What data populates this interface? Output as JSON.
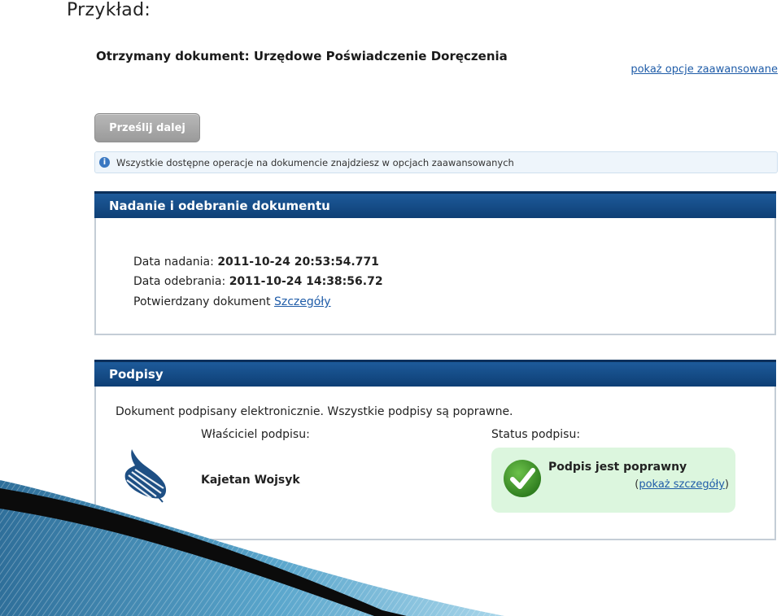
{
  "slide": {
    "title": "Przykład:"
  },
  "document": {
    "title": "Otrzymany dokument: Urzędowe Poświadczenie Doręczenia",
    "advanced_link": "pokaż opcje zaawansowane",
    "forward_button": "Prześlij dalej",
    "info_text": "Wszystkie dostępne operacje na dokumencie znajdziesz w opcjach zaawansowanych"
  },
  "delivery_panel": {
    "title": "Nadanie i odebranie dokumentu",
    "sent_label": "Data nadania:",
    "sent_value": "2011-10-24 20:53:54.771",
    "received_label": "Data odebrania:",
    "received_value": "2011-10-24 14:38:56.72",
    "confirmed_label": "Potwierdzany dokument",
    "details_link": "Szczegóły"
  },
  "signatures_panel": {
    "title": "Podpisy",
    "intro": "Dokument podpisany elektronicznie. Wszystkie podpisy są poprawne.",
    "owner_label": "Właściciel podpisu:",
    "status_label": "Status podpisu:",
    "owner_name": "Kajetan Wojsyk",
    "status_text": "Podpis jest poprawny",
    "details_open": "(",
    "details_link": "pokaż szczegóły",
    "details_close": ")"
  },
  "colors": {
    "header_blue": "#0e3f75",
    "link_blue": "#1f5ca8",
    "status_green_bg": "#dcf6de",
    "check_green": "#3f9a2c"
  },
  "icons": [
    "info-icon",
    "signature-pen-icon",
    "checkmark-icon"
  ]
}
